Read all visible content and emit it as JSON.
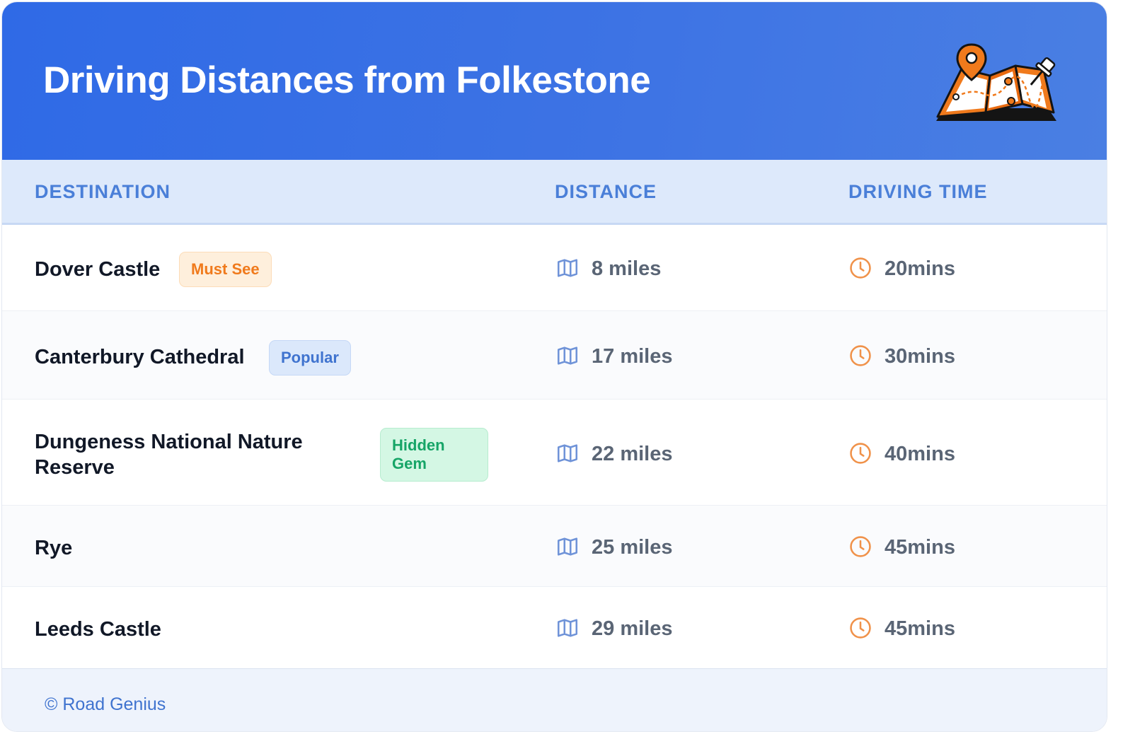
{
  "header": {
    "title": "Driving Distances from Folkestone"
  },
  "columns": {
    "destination": "DESTINATION",
    "distance": "DISTANCE",
    "driving_time": "DRIVING TIME"
  },
  "rows": [
    {
      "destination": "Dover Castle",
      "badge": "Must See",
      "badge_color": "#f07a1c",
      "distance": "8 miles",
      "time": "20mins"
    },
    {
      "destination": "Canterbury Cathedral",
      "badge": "Popular",
      "badge_color": "#3f73cf",
      "distance": "17 miles",
      "time": "30mins"
    },
    {
      "destination": "Dungeness National Nature Reserve",
      "badge": "Hidden Gem",
      "badge_color": "#16a567",
      "distance": "22 miles",
      "time": "40mins"
    },
    {
      "destination": "Rye",
      "badge": "",
      "distance": "25 miles",
      "time": "45mins"
    },
    {
      "destination": "Leeds Castle",
      "badge": "",
      "distance": "29 miles",
      "time": "45mins"
    }
  ],
  "icons": {
    "header": "folded-map-with-pins-icon",
    "distance": "map-icon",
    "time": "clock-icon"
  },
  "footer": {
    "credit": "© Road Genius"
  },
  "colors": {
    "header_blue": "#2f6ae6",
    "accent_orange": "#f07a1c",
    "column_header": "#4a7fd8"
  }
}
